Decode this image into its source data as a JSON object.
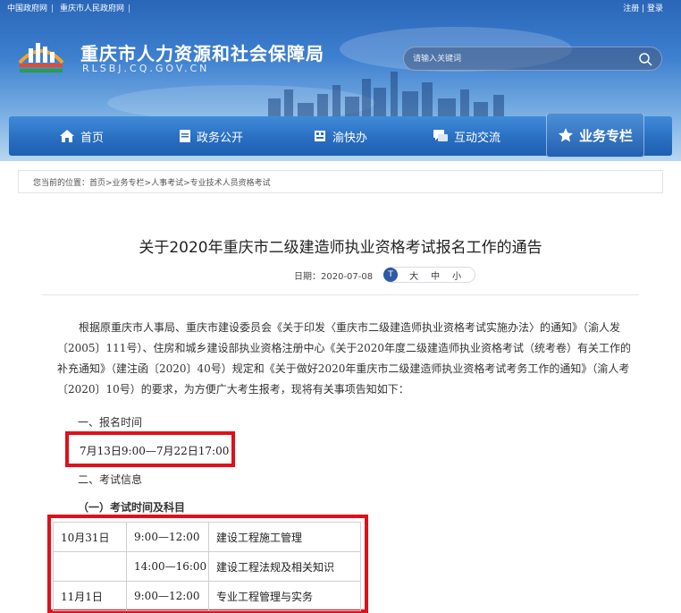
{
  "header": {
    "top_links": [
      "中国政府网",
      "重庆市人民政府网"
    ],
    "user_links": "注册 | 登录",
    "site_title": "重庆市人力资源和社会保障局",
    "site_url": "RLSBJ.CQ.GOV.CN",
    "search_placeholder": "请输入关键词"
  },
  "nav": {
    "items": [
      "首页",
      "政务公开",
      "渝快办",
      "互动交流",
      "业务专栏"
    ],
    "active_index": 4
  },
  "breadcrumb": "您当前的位置：首页>业务专栏>人事考试>专业技术人员资格考试",
  "article": {
    "title": "关于2020年重庆市二级建造师执业资格考试报名工作的通告",
    "date_label": "日期：2020-07-08",
    "font_icon": "T",
    "font_sizes": [
      "大",
      "中",
      "小"
    ],
    "paragraph": "根据原重庆市人事局、重庆市建设委员会《关于印发〈重庆市二级建造师执业资格考试实施办法〉的通知》（渝人发〔2005〕111号）、住房和城乡建设部执业资格注册中心《关于2020年度二级建造师执业资格考试（统考卷）有关工作的补充通知》（建注函〔2020〕40号）规定和《关于做好2020年重庆市二级建造师执业资格考试考务工作的通知》（渝人考〔2020〕10号）的要求，为方便广大考生报考，现将有关事项告知如下：",
    "section1": "一、报名时间",
    "reg_time": "7月13日9:00—7月22日17:00",
    "section2": "二、考试信息",
    "subsection": "（一）考试时间及科目",
    "schedule": [
      {
        "date": "10月31日",
        "time": "9:00—12:00",
        "subject": "建设工程施工管理"
      },
      {
        "date": "",
        "time": "14:00—16:00",
        "subject": "建设工程法规及相关知识"
      },
      {
        "date": "11月1日",
        "time": "9:00—12:00",
        "subject": "专业工程管理与实务"
      }
    ]
  },
  "colors": {
    "nav_blue": "#2a6fc2",
    "highlight_red": "#e0101a"
  },
  "icons": [
    "logo-emblem",
    "search-icon",
    "home-icon",
    "document-icon",
    "building-icon",
    "chat-icon",
    "star-icon",
    "font-size-icon"
  ]
}
